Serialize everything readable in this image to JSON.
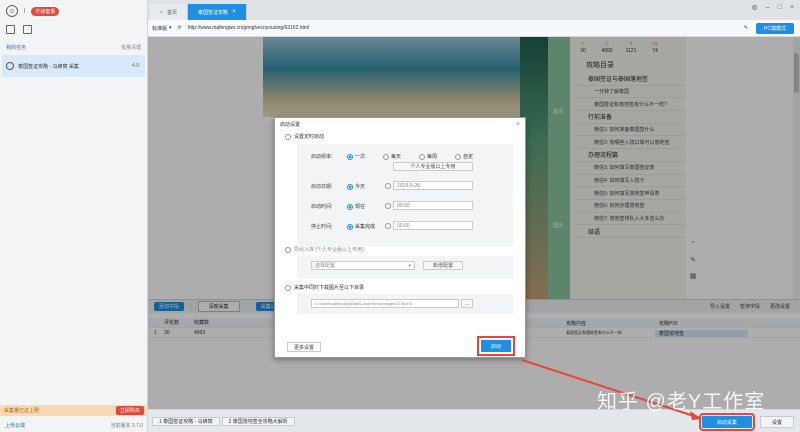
{
  "app": {
    "upgrade_label": "升级套餐",
    "tasks_section": "我的任务",
    "clear_label": "批量清理",
    "task_item": "泰国签证攻略 - 马蜂窝 采集",
    "task_count": "4.0"
  },
  "tabs": [
    {
      "label": "首页"
    },
    {
      "label": "泰国签证攻略"
    }
  ],
  "address": {
    "mode": "标准版",
    "url": "http://www.mafengwo.cn/gonglve/ziyouxing/63162.html",
    "pc_button": "PC端模式"
  },
  "toc": {
    "stats": [
      "30",
      "4993",
      "1121",
      "74"
    ],
    "title": "攻略目录",
    "items": [
      {
        "text": "泰国签证与泰国落地签",
        "group": true
      },
      {
        "text": "一分钟了解泰国",
        "group": false
      },
      {
        "text": "泰国签证和落地签有什么不一样?",
        "group": false
      },
      {
        "text": "行前准备",
        "group": true
      },
      {
        "text": "微信1: 如何准备泰国签什么",
        "group": false
      },
      {
        "text": "微信2: 有哪些入境口岸可以落地签",
        "group": false
      },
      {
        "text": "办理流程篇",
        "group": true
      },
      {
        "text": "微信3: 如何填写泰国签证表",
        "group": false
      },
      {
        "text": "微信4: 如何填写入境卡",
        "group": false
      },
      {
        "text": "微信5: 如何填写落地签申请表",
        "group": false
      },
      {
        "text": "微信6: 如何办理落地签",
        "group": false
      },
      {
        "text": "微信7: 落地签排队入大多怎么办",
        "group": false
      },
      {
        "text": "结语",
        "group": true
      }
    ],
    "green_labels": [
      "首页",
      "国庆"
    ]
  },
  "data_area": {
    "add_field": "添加字段",
    "type_select": "深度采集",
    "batch_label": "采集设置",
    "right_tools": [
      "导入设置",
      "暂停字段",
      "更改设置"
    ],
    "columns": [
      "评论数",
      "收藏数"
    ],
    "row": [
      "30",
      "4993"
    ],
    "right_columns": [
      "攻略内容",
      "攻略POI"
    ],
    "right_row": [
      "泰国签证和落地签有什么不一样",
      "泰国落地签"
    ]
  },
  "status": {
    "warning": "采集量已达上限",
    "buy_label": "立即购买",
    "upload_label": "上传云端",
    "version": "当前版本 3.7.0",
    "tabs": [
      "1 泰国签证攻略 - 马蜂窝",
      "2 泰国落地签全攻略大解析"
    ],
    "start_button": "启动采集",
    "settings_button": "设置"
  },
  "dialog": {
    "title": "启动设置",
    "opt_timer": "设置定时启动",
    "freq_label": "启动频率:",
    "freq_options": [
      "一次",
      "每天",
      "每周",
      "自定"
    ],
    "freq_hint": "个人专业版以上专用",
    "date_label": "启动日期:",
    "date_today": "今天",
    "date_value": "2018-9-28",
    "time_label": "启动时间:",
    "time_now": "现在",
    "time_value": "00:00",
    "stop_label": "停止时间:",
    "stop_done": "采集完成",
    "stop_value": "00:00",
    "opt_auto": "导出入库 (个人专业版以上专用)",
    "auto_select": "选择配置",
    "auto_btn": "新增配置",
    "opt_images": "采集中同时下载图片至以下目录",
    "image_path": "C:\\Users\\admin\\AppData\\Local\\Temp\\Images\\27361E5",
    "browse": "...",
    "less_btn": "更多设置",
    "start_btn": "启动"
  },
  "watermark": "知乎 @老Y工作室",
  "colors": {
    "accent": "#1e8fe1",
    "alert": "#e8453c"
  }
}
